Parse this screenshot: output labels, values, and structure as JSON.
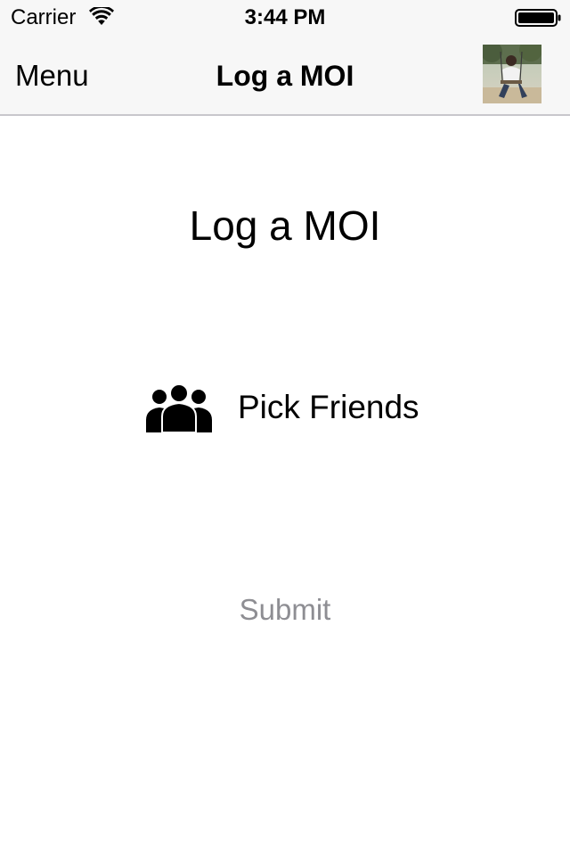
{
  "status_bar": {
    "carrier": "Carrier",
    "time": "3:44 PM",
    "wifi_icon": "wifi-icon",
    "battery_icon": "battery-full-icon"
  },
  "nav": {
    "menu_label": "Menu",
    "title": "Log a MOI",
    "avatar": "user-avatar-photo"
  },
  "main": {
    "heading": "Log a MOI",
    "pick_friends_label": "Pick Friends",
    "pick_friends_icon": "group-people-icon",
    "submit_label": "Submit"
  },
  "colors": {
    "bar_background": "#f7f7f7",
    "separator": "#c8c7cc",
    "submit_disabled": "#8e8e93",
    "text": "#000000"
  }
}
